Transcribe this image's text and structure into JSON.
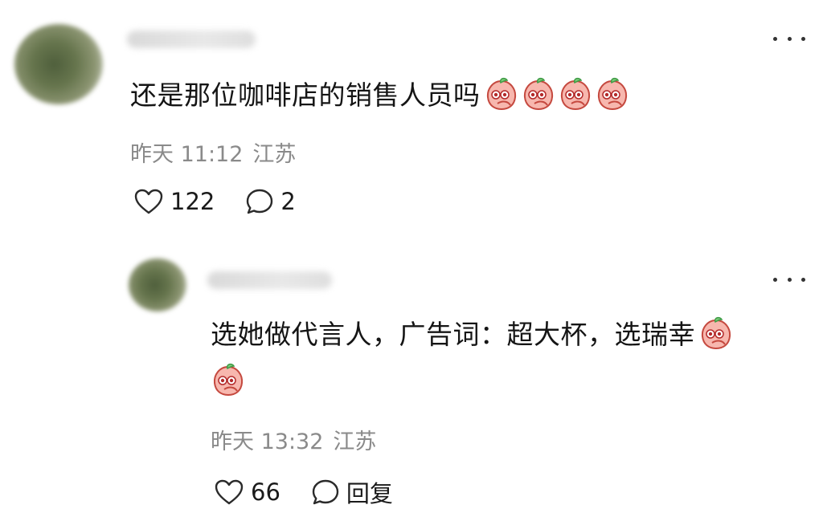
{
  "comments": [
    {
      "text": "还是那位咖啡店的销售人员吗",
      "emojis": [
        "peach-emoji",
        "peach-emoji",
        "peach-emoji",
        "peach-emoji"
      ],
      "time": "昨天 11:12",
      "location": "江苏",
      "likes": "122",
      "replies": "2"
    },
    {
      "text": "选她做代言人，广告词：超大杯，选瑞幸",
      "emojis": [
        "peach-emoji",
        "peach-emoji"
      ],
      "time": "昨天 13:32",
      "location": "江苏",
      "likes": "66",
      "reply_label": "回复"
    }
  ],
  "icons": {
    "more": "more-dots-icon",
    "like": "heart-icon",
    "reply": "comment-bubble-icon"
  }
}
